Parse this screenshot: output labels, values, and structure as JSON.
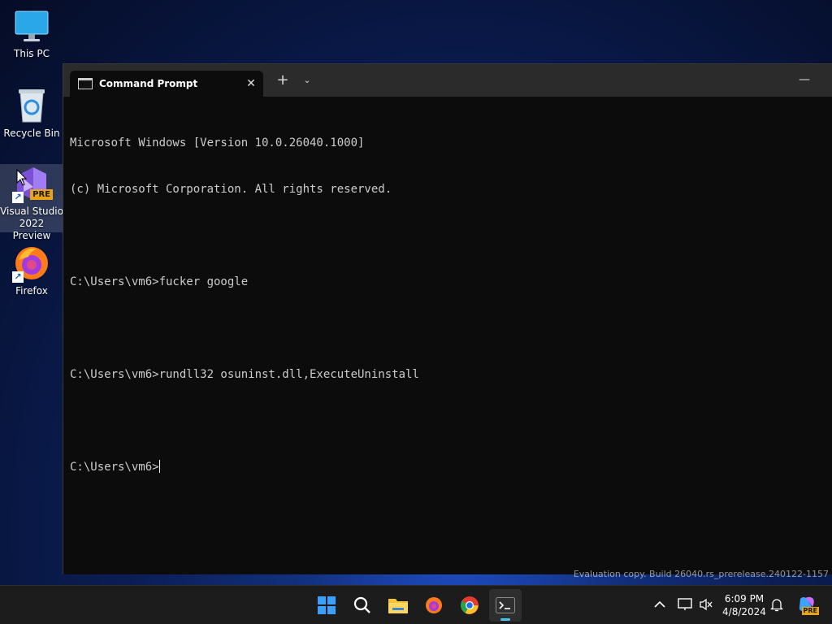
{
  "desktop": {
    "icons": [
      {
        "label": "This PC"
      },
      {
        "label": "Recycle Bin"
      },
      {
        "label": "Visual Studio 2022 Preview",
        "badge": "PRE"
      },
      {
        "label": "Firefox"
      }
    ]
  },
  "terminal": {
    "tab_title": "Command Prompt",
    "close_glyph": "✕",
    "new_tab_glyph": "+",
    "dropdown_glyph": "⌄",
    "minimize_glyph": "—",
    "lines": [
      "Microsoft Windows [Version 10.0.26040.1000]",
      "(c) Microsoft Corporation. All rights reserved.",
      "",
      "C:\\Users\\vm6>fucker google",
      "",
      "C:\\Users\\vm6>rundll32 osuninst.dll,ExecuteUninstall",
      "",
      "C:\\Users\\vm6>"
    ]
  },
  "watermark": "Evaluation copy. Build 26040.rs_prerelease.240122-1157",
  "taskbar": {
    "time": "6:09 PM",
    "date": "4/8/2024",
    "copilot_badge": "PRE",
    "colors": {
      "accent": "#4cc2ff",
      "background": "#1c1c1c"
    }
  }
}
